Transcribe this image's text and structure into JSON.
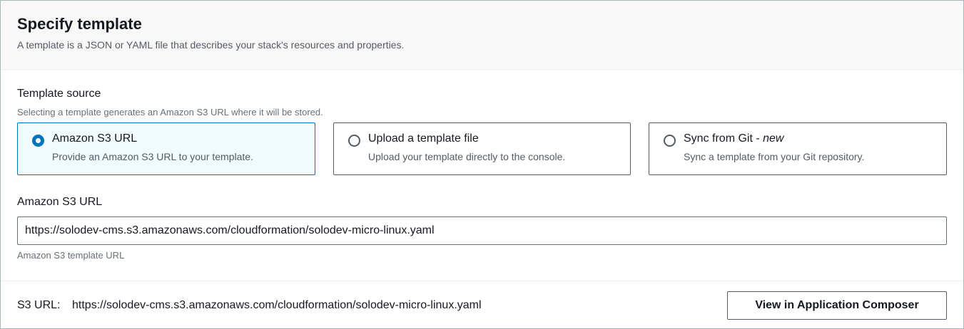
{
  "header": {
    "title": "Specify template",
    "description": "A template is a JSON or YAML file that describes your stack's resources and properties."
  },
  "template_source": {
    "label": "Template source",
    "hint": "Selecting a template generates an Amazon S3 URL where it will be stored.",
    "options": [
      {
        "title": "Amazon S3 URL",
        "tag": "",
        "description": "Provide an Amazon S3 URL to your template.",
        "selected": true
      },
      {
        "title": "Upload a template file",
        "tag": "",
        "description": "Upload your template directly to the console.",
        "selected": false
      },
      {
        "title": "Sync from Git - ",
        "tag": "new",
        "description": "Sync a template from your Git repository.",
        "selected": false
      }
    ]
  },
  "s3_url_field": {
    "label": "Amazon S3 URL",
    "value": "https://solodev-cms.s3.amazonaws.com/cloudformation/solodev-micro-linux.yaml",
    "hint": "Amazon S3 template URL"
  },
  "footer": {
    "s3_url_label": "S3 URL:",
    "s3_url_value": "https://solodev-cms.s3.amazonaws.com/cloudformation/solodev-micro-linux.yaml",
    "button_label": "View in Application Composer"
  },
  "colors": {
    "accent": "#0073bb",
    "selected_background": "#f1faff",
    "header_background": "#f8f8f8"
  },
  "icons": {
    "radio_selected": "radio-selected-icon",
    "radio_unselected": "radio-unselected-icon"
  }
}
